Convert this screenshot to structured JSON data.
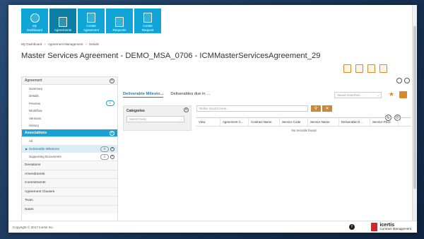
{
  "nav": [
    {
      "label1": "My",
      "label2": "Dashboard"
    },
    {
      "label1": "Agreements",
      "label2": ""
    },
    {
      "label1": "Create",
      "label2": "Agreement"
    },
    {
      "label1": "Requests",
      "label2": ""
    },
    {
      "label1": "Create",
      "label2": "Request"
    }
  ],
  "breadcrumb": {
    "home": "My Dashboard",
    "section": "Agreement Management",
    "current": "Details",
    "sep": ">"
  },
  "page": {
    "title": "Master Services Agreement - DEMO_MSA_0706 - ICMMasterServicesAgreement_29"
  },
  "sidebar": {
    "agreement_header": "Agreement",
    "agreement_items": [
      {
        "label": "Summary",
        "badge": ""
      },
      {
        "label": "Details",
        "badge": ""
      },
      {
        "label": "Preview",
        "badge": "1"
      },
      {
        "label": "Workflow",
        "badge": ""
      },
      {
        "label": "Versions",
        "badge": ""
      },
      {
        "label": "History",
        "badge": ""
      }
    ],
    "associations_header": "Associations",
    "association_items": [
      {
        "label": "All",
        "badge": ""
      },
      {
        "label": "Deliverable Milestone",
        "badge": "0"
      },
      {
        "label": "Supporting Documents",
        "badge": "0"
      }
    ],
    "categories": [
      "Deviations",
      "Amendments",
      "Commitments",
      "Agreement Clauses",
      "Team",
      "Notes"
    ]
  },
  "main": {
    "tabs": [
      "Deliverable Milesto...",
      "Deliverables due in ..."
    ],
    "saved_searches_placeholder": "Saved Searches...",
    "categories_title": "Categories",
    "select_field_placeholder": "Select Field...",
    "search_placeholder": "Refine Search Here...",
    "columns": [
      "View",
      "Agreement C...",
      "Contract Name",
      "Service Code",
      "Service Name",
      "Deliverable D...",
      "Service Price"
    ],
    "no_records": "No records found"
  },
  "footer": {
    "copyright": "Copyright © 2017 Icertis Inc.",
    "brand": "icertis",
    "brand_sub": "Contract Management"
  },
  "colors": {
    "nav_tile": "#10a5d6",
    "accent_orange": "#d88a2a",
    "active_blue": "#1ba2d4",
    "brand_red": "#d8232a"
  }
}
